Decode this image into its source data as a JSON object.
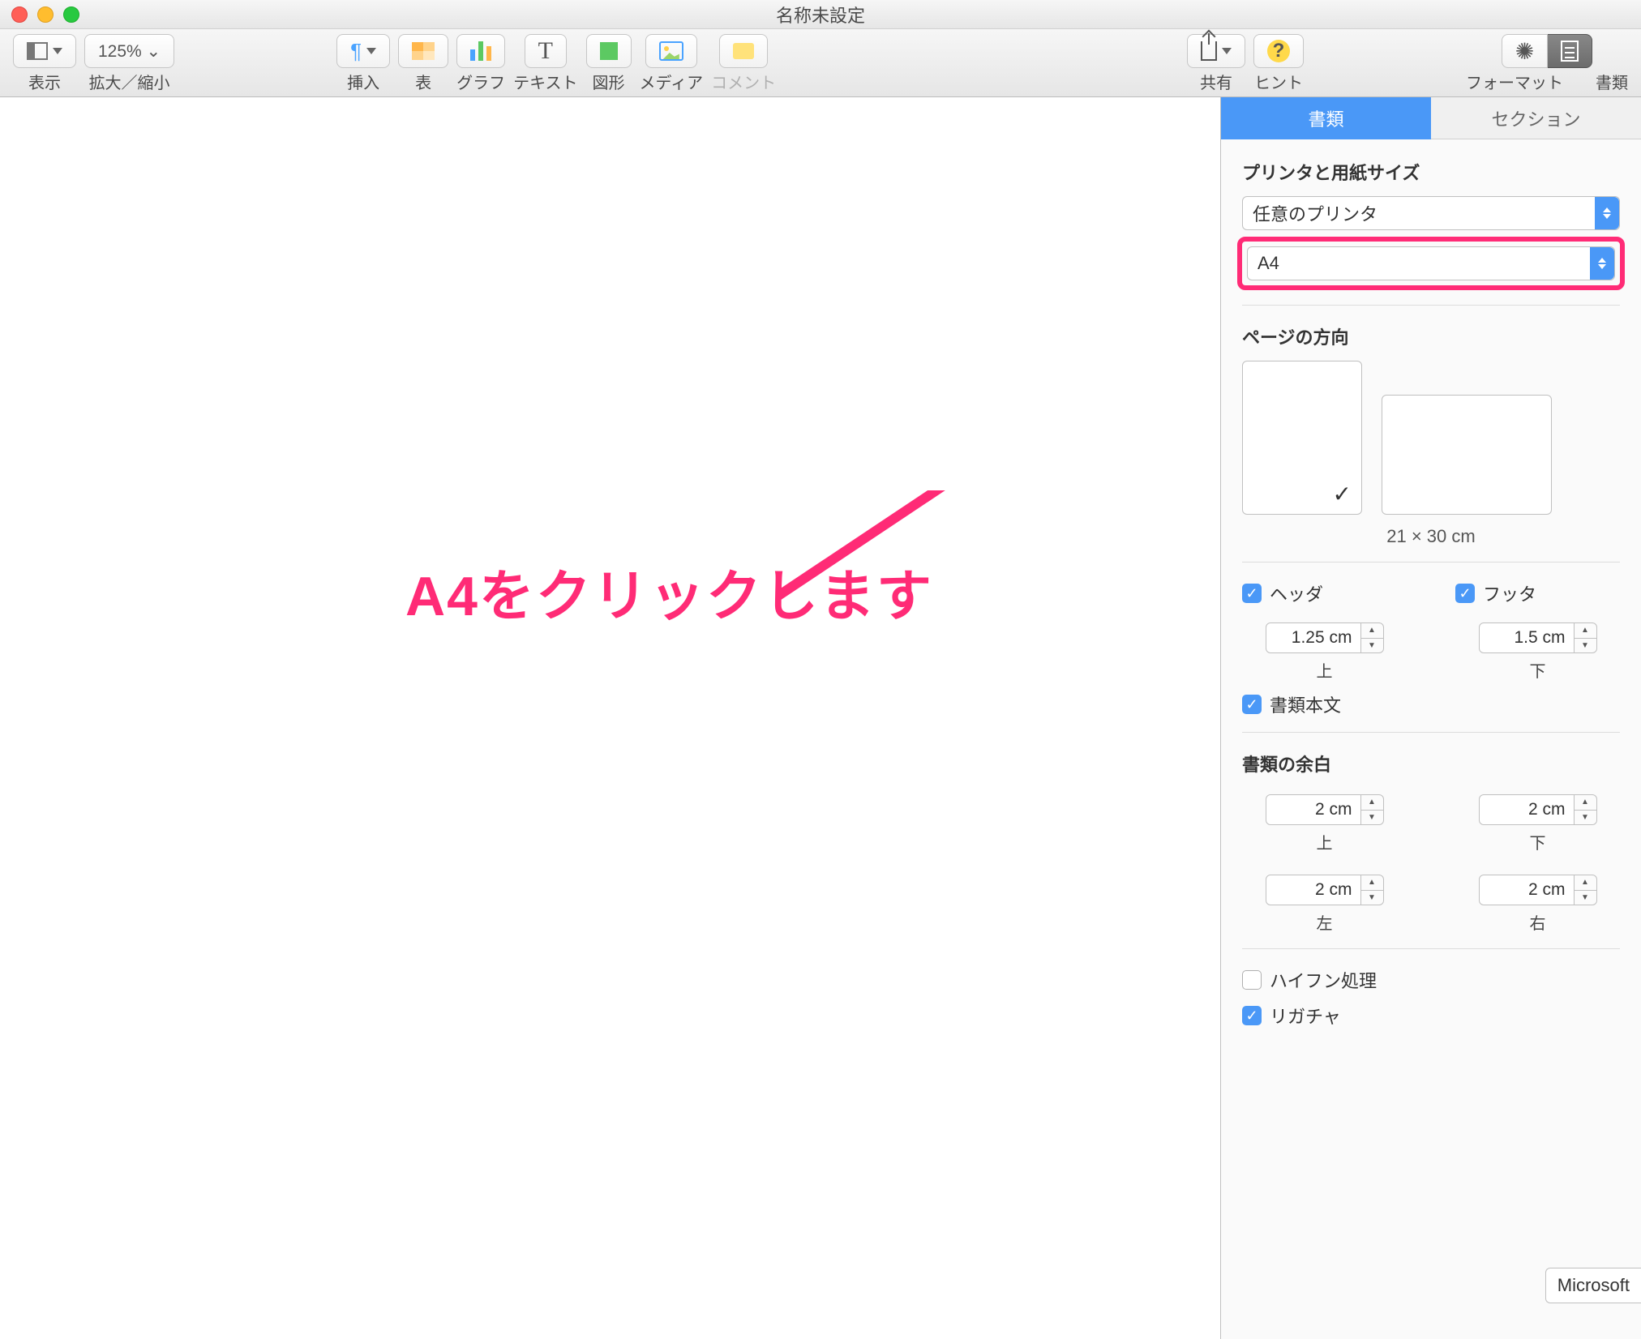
{
  "window": {
    "title": "名称未設定"
  },
  "toolbar": {
    "view": "表示",
    "zoom_value": "125% ⌄",
    "zoom_label": "拡大／縮小",
    "insert": "挿入",
    "table": "表",
    "chart": "グラフ",
    "text": "テキスト",
    "shape": "図形",
    "media": "メディア",
    "comment": "コメント",
    "share": "共有",
    "hint": "ヒント",
    "format": "フォーマット",
    "document": "書類"
  },
  "inspector": {
    "tabs": {
      "document": "書類",
      "section": "セクション"
    },
    "printer_section": "プリンタと用紙サイズ",
    "printer_value": "任意のプリンタ",
    "paper_value": "A4",
    "orientation_section": "ページの方向",
    "paper_size_text": "21 × 30 cm",
    "header_label": "ヘッダ",
    "footer_label": "フッタ",
    "header_value": "1.25 cm",
    "footer_value": "1.5 cm",
    "top_label": "上",
    "bottom_label": "下",
    "body_label": "書類本文",
    "margins_section": "書類の余白",
    "margins": {
      "top": "2 cm",
      "bottom": "2 cm",
      "left": "2 cm",
      "right": "2 cm",
      "top_label": "上",
      "bottom_label": "下",
      "left_label": "左",
      "right_label": "右"
    },
    "hyphen_label": "ハイフン処理",
    "ligature_label": "リガチャ"
  },
  "annotation": {
    "text": "A4をクリックします"
  },
  "tooltip": {
    "ms": "Microsoft"
  }
}
